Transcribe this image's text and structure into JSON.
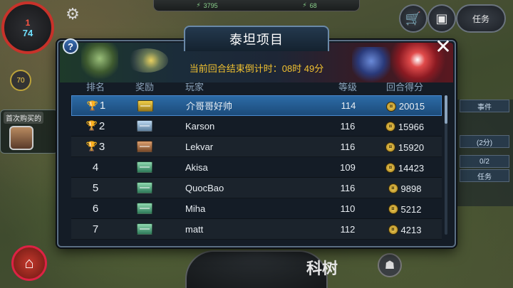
{
  "hud": {
    "resource_1": "3795",
    "resource_2": "68",
    "base_health": "1",
    "base_water": "74",
    "level_badge": "70",
    "first_buy_label": "首次购买的",
    "side_tag_event": "事件",
    "side_tag_text": "(2分)",
    "side_tag_count": "0/2",
    "side_tag_task": "任务",
    "bottom_text": "科树",
    "quests_label": "任务"
  },
  "dialog": {
    "title": "泰坦项目",
    "countdown_label": "当前回合结束倒计时：",
    "countdown_value": "08时 49分",
    "close_symbol": "✕",
    "help_symbol": "?"
  },
  "table": {
    "headers": {
      "rank": "排名",
      "reward": "奖励",
      "player": "玩家",
      "level": "等级",
      "score": "回合得分"
    },
    "rows": [
      {
        "rank": "1",
        "trophy": "gold",
        "crate": "gold",
        "player": "介哥哥好帅",
        "level": "114",
        "score": "20015"
      },
      {
        "rank": "2",
        "trophy": "silver",
        "crate": "silver",
        "player": "Karson",
        "level": "116",
        "score": "15966"
      },
      {
        "rank": "3",
        "trophy": "bronze",
        "crate": "bronze",
        "player": "Lekvar",
        "level": "116",
        "score": "15920"
      },
      {
        "rank": "4",
        "trophy": "",
        "crate": "green",
        "player": "Akisa",
        "level": "109",
        "score": "14423"
      },
      {
        "rank": "5",
        "trophy": "",
        "crate": "green",
        "player": "QuocBao",
        "level": "116",
        "score": "9898"
      },
      {
        "rank": "6",
        "trophy": "",
        "crate": "green",
        "player": "Miha",
        "level": "110",
        "score": "5212"
      },
      {
        "rank": "7",
        "trophy": "",
        "crate": "green",
        "player": "matt",
        "level": "112",
        "score": "4213"
      }
    ]
  },
  "colors": {
    "highlight_row": "#2c6ba6",
    "countdown": "#f2c230",
    "panel_bg": "#141c26",
    "header_text": "#8da5bd"
  }
}
